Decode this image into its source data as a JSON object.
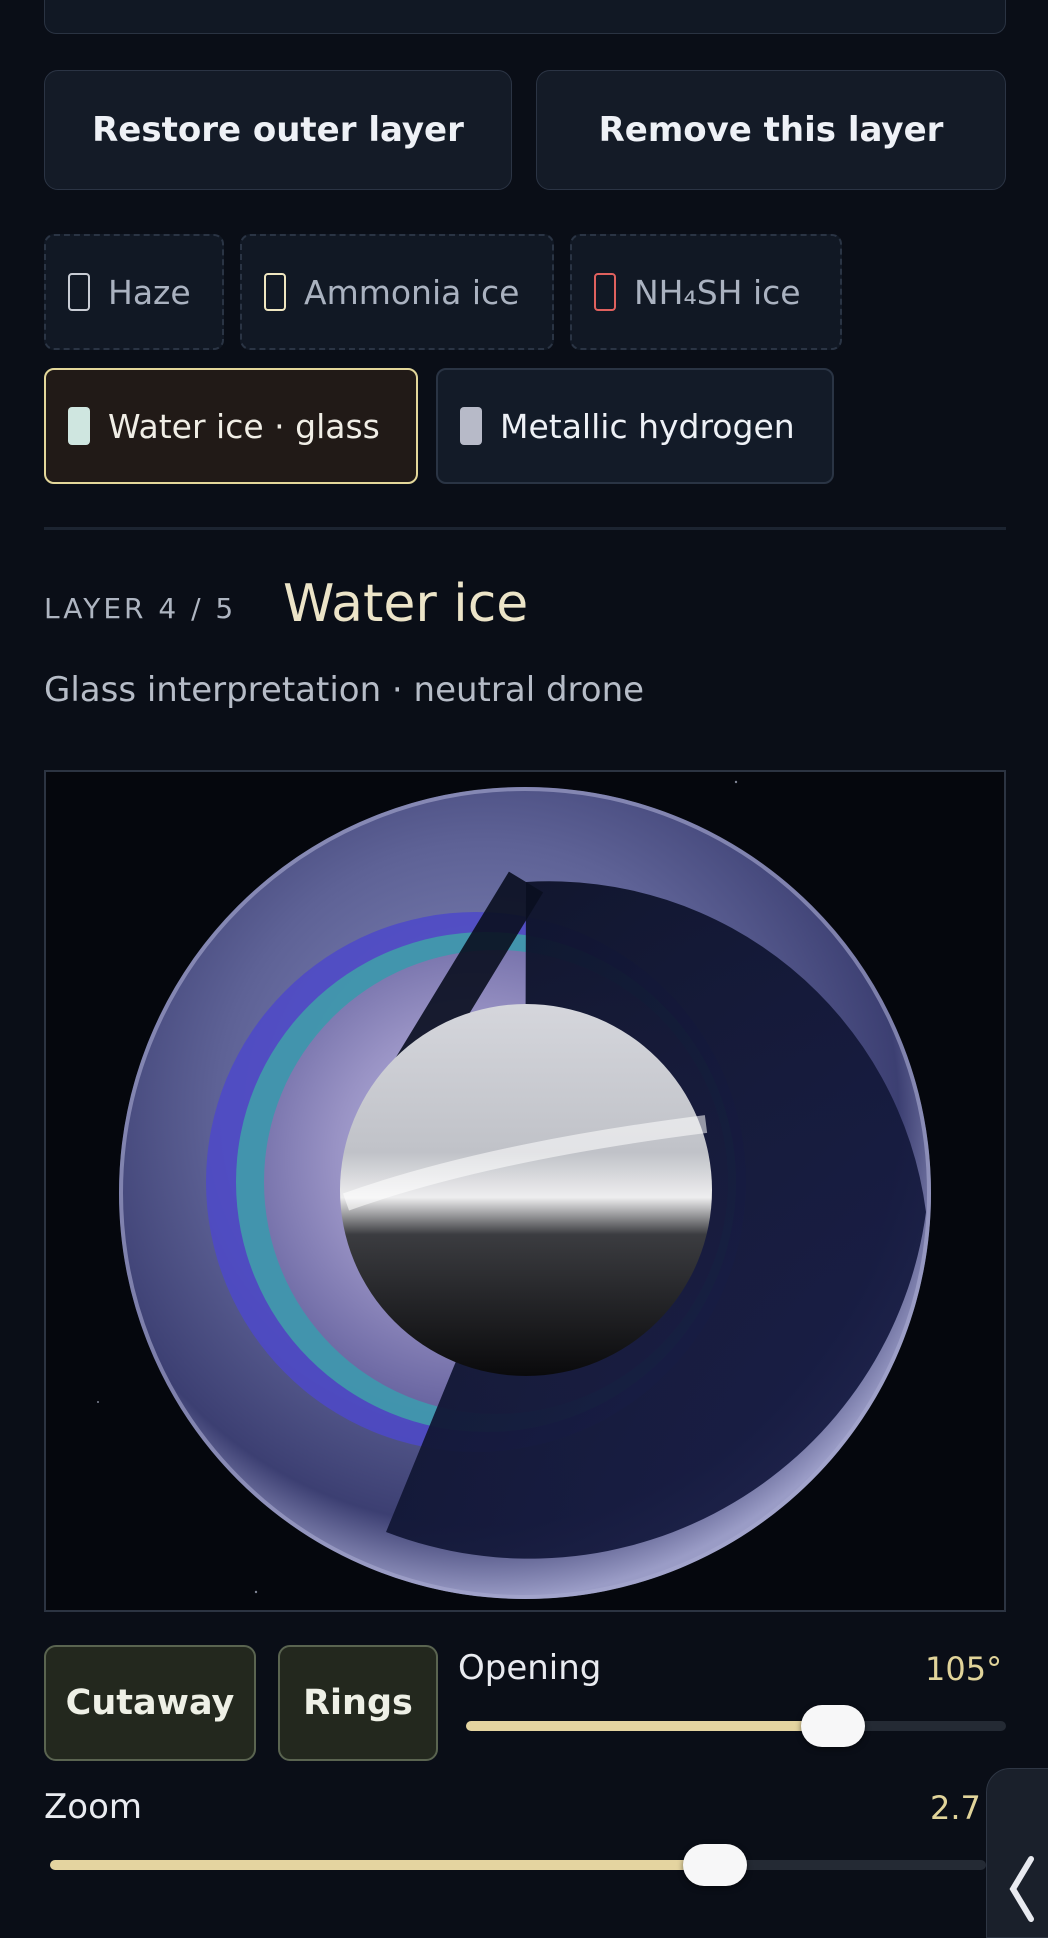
{
  "actions": {
    "restore_label": "Restore outer layer",
    "remove_label": "Remove this layer"
  },
  "layers": [
    {
      "label": "Haze",
      "swatch": "#c8ccd4",
      "state": "removed"
    },
    {
      "label": "Ammonia ice",
      "swatch": "#efe6c0",
      "state": "removed"
    },
    {
      "label": "NH₄SH ice",
      "swatch": "#e0615e",
      "state": "removed"
    },
    {
      "label": "Water ice · glass",
      "swatch": "#cfe6e0",
      "state": "selected"
    },
    {
      "label": "Metallic hydrogen",
      "swatch": "#b7bac8",
      "state": "present"
    }
  ],
  "detail": {
    "layer_index": "LAYER 4 / 5",
    "title": "Water ice",
    "subtitle": "Glass interpretation · neutral drone"
  },
  "controls": {
    "cutaway_label": "Cutaway",
    "rings_label": "Rings",
    "opening": {
      "label": "Opening",
      "value_text": "105°",
      "fraction": 0.68
    },
    "zoom": {
      "label": "Zoom",
      "value_text": "2.7",
      "fraction": 0.71
    }
  },
  "colors": {
    "accent": "#e3d79a",
    "background": "#0a0e17"
  }
}
